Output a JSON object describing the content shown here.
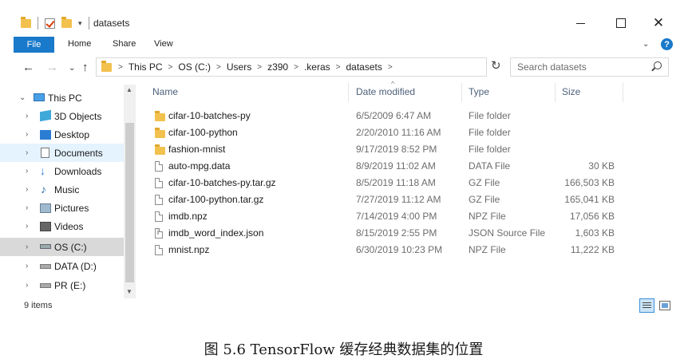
{
  "window": {
    "title": "datasets",
    "minimize_icon": "minimize-icon",
    "maximize_icon": "maximize-icon",
    "close_symbol": "✕"
  },
  "ribbon": {
    "tabs": [
      "File",
      "Home",
      "Share",
      "View"
    ],
    "expand_symbol": "⌄",
    "help_symbol": "?"
  },
  "nav": {
    "back": "←",
    "forward": "→",
    "recent": "⌄",
    "up": "↑",
    "breadcrumb": [
      "This PC",
      "OS (C:)",
      "Users",
      "z390",
      ".keras",
      "datasets"
    ],
    "search_placeholder": "Search datasets",
    "refresh": "↻"
  },
  "sidebar": {
    "items": [
      {
        "label": "This PC",
        "icon": "computer-icon",
        "expanded": true
      },
      {
        "label": "3D Objects",
        "icon": "cube-icon"
      },
      {
        "label": "Desktop",
        "icon": "desktop-icon"
      },
      {
        "label": "Documents",
        "icon": "documents-icon",
        "selected": true
      },
      {
        "label": "Downloads",
        "icon": "download-icon"
      },
      {
        "label": "Music",
        "icon": "music-icon"
      },
      {
        "label": "Pictures",
        "icon": "pictures-icon"
      },
      {
        "label": "Videos",
        "icon": "videos-icon"
      },
      {
        "label": "OS (C:)",
        "icon": "drive-icon",
        "current": true
      },
      {
        "label": "DATA (D:)",
        "icon": "drive-icon"
      },
      {
        "label": "PR (E:)",
        "icon": "drive-icon"
      }
    ]
  },
  "columns": [
    "Name",
    "Date modified",
    "Type",
    "Size"
  ],
  "files": [
    {
      "name": "cifar-10-batches-py",
      "date": "6/5/2009 6:47 AM",
      "type": "File folder",
      "size": "",
      "icon": "folder-icon"
    },
    {
      "name": "cifar-100-python",
      "date": "2/20/2010 11:16 AM",
      "type": "File folder",
      "size": "",
      "icon": "folder-icon"
    },
    {
      "name": "fashion-mnist",
      "date": "9/17/2019 8:52 PM",
      "type": "File folder",
      "size": "",
      "icon": "folder-icon"
    },
    {
      "name": "auto-mpg.data",
      "date": "8/9/2019 11:02 AM",
      "type": "DATA File",
      "size": "30 KB",
      "icon": "file-icon"
    },
    {
      "name": "cifar-10-batches-py.tar.gz",
      "date": "8/5/2019 11:18 AM",
      "type": "GZ File",
      "size": "166,503 KB",
      "icon": "file-icon"
    },
    {
      "name": "cifar-100-python.tar.gz",
      "date": "7/27/2019 11:12 AM",
      "type": "GZ File",
      "size": "165,041 KB",
      "icon": "file-icon"
    },
    {
      "name": "imdb.npz",
      "date": "7/14/2019 4:00 PM",
      "type": "NPZ File",
      "size": "17,056 KB",
      "icon": "file-icon"
    },
    {
      "name": "imdb_word_index.json",
      "date": "8/15/2019 2:55 PM",
      "type": "JSON Source File",
      "size": "1,603 KB",
      "icon": "json-file-icon"
    },
    {
      "name": "mnist.npz",
      "date": "6/30/2019 10:23 PM",
      "type": "NPZ File",
      "size": "11,222 KB",
      "icon": "file-icon"
    }
  ],
  "status": {
    "item_count": "9 items"
  },
  "caption": "图  5.6 TensorFlow 缓存经典数据集的位置"
}
